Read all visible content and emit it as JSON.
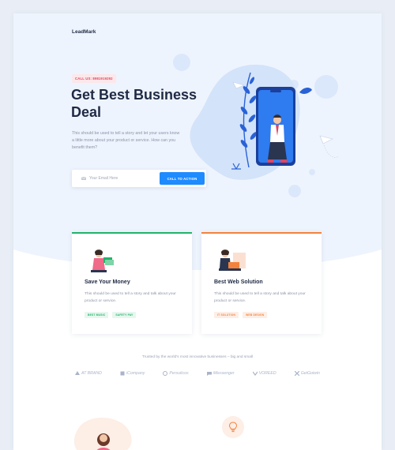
{
  "header": {
    "logo": "LeadMark"
  },
  "hero": {
    "call_badge": "CALL US: 8981919292",
    "title": "Get Best Business Deal",
    "description": "This should be used to tell a story and let your users know a little more about your product or service. How can you benefit them?",
    "email_placeholder": "Your Email Here",
    "cta_label": "CALL TO ACTION"
  },
  "cards": [
    {
      "title": "Save Your Money",
      "text": "This should be used to tell a story and talk about your product or service.",
      "tags": [
        "BEST MUSIC",
        "SAFETY PAY"
      ]
    },
    {
      "title": "Best Web Solution",
      "text": "This should be used to tell a story and talk about your product or service.",
      "tags": [
        "IT SOLUTION",
        "WEB DESIGN"
      ]
    }
  ],
  "trusted": {
    "text": "Trusted by the world's most innovative businesses – big and small",
    "brands": [
      "AT BRAND",
      "iCompany",
      "Persuitcos",
      "iMessenger",
      "VOREED",
      "GetGoiwin"
    ]
  },
  "colors": {
    "accent": "#1e8bff",
    "green": "#24b26b",
    "orange": "#f4823c",
    "badge": "#e0455f",
    "heading": "#1f2a44"
  }
}
